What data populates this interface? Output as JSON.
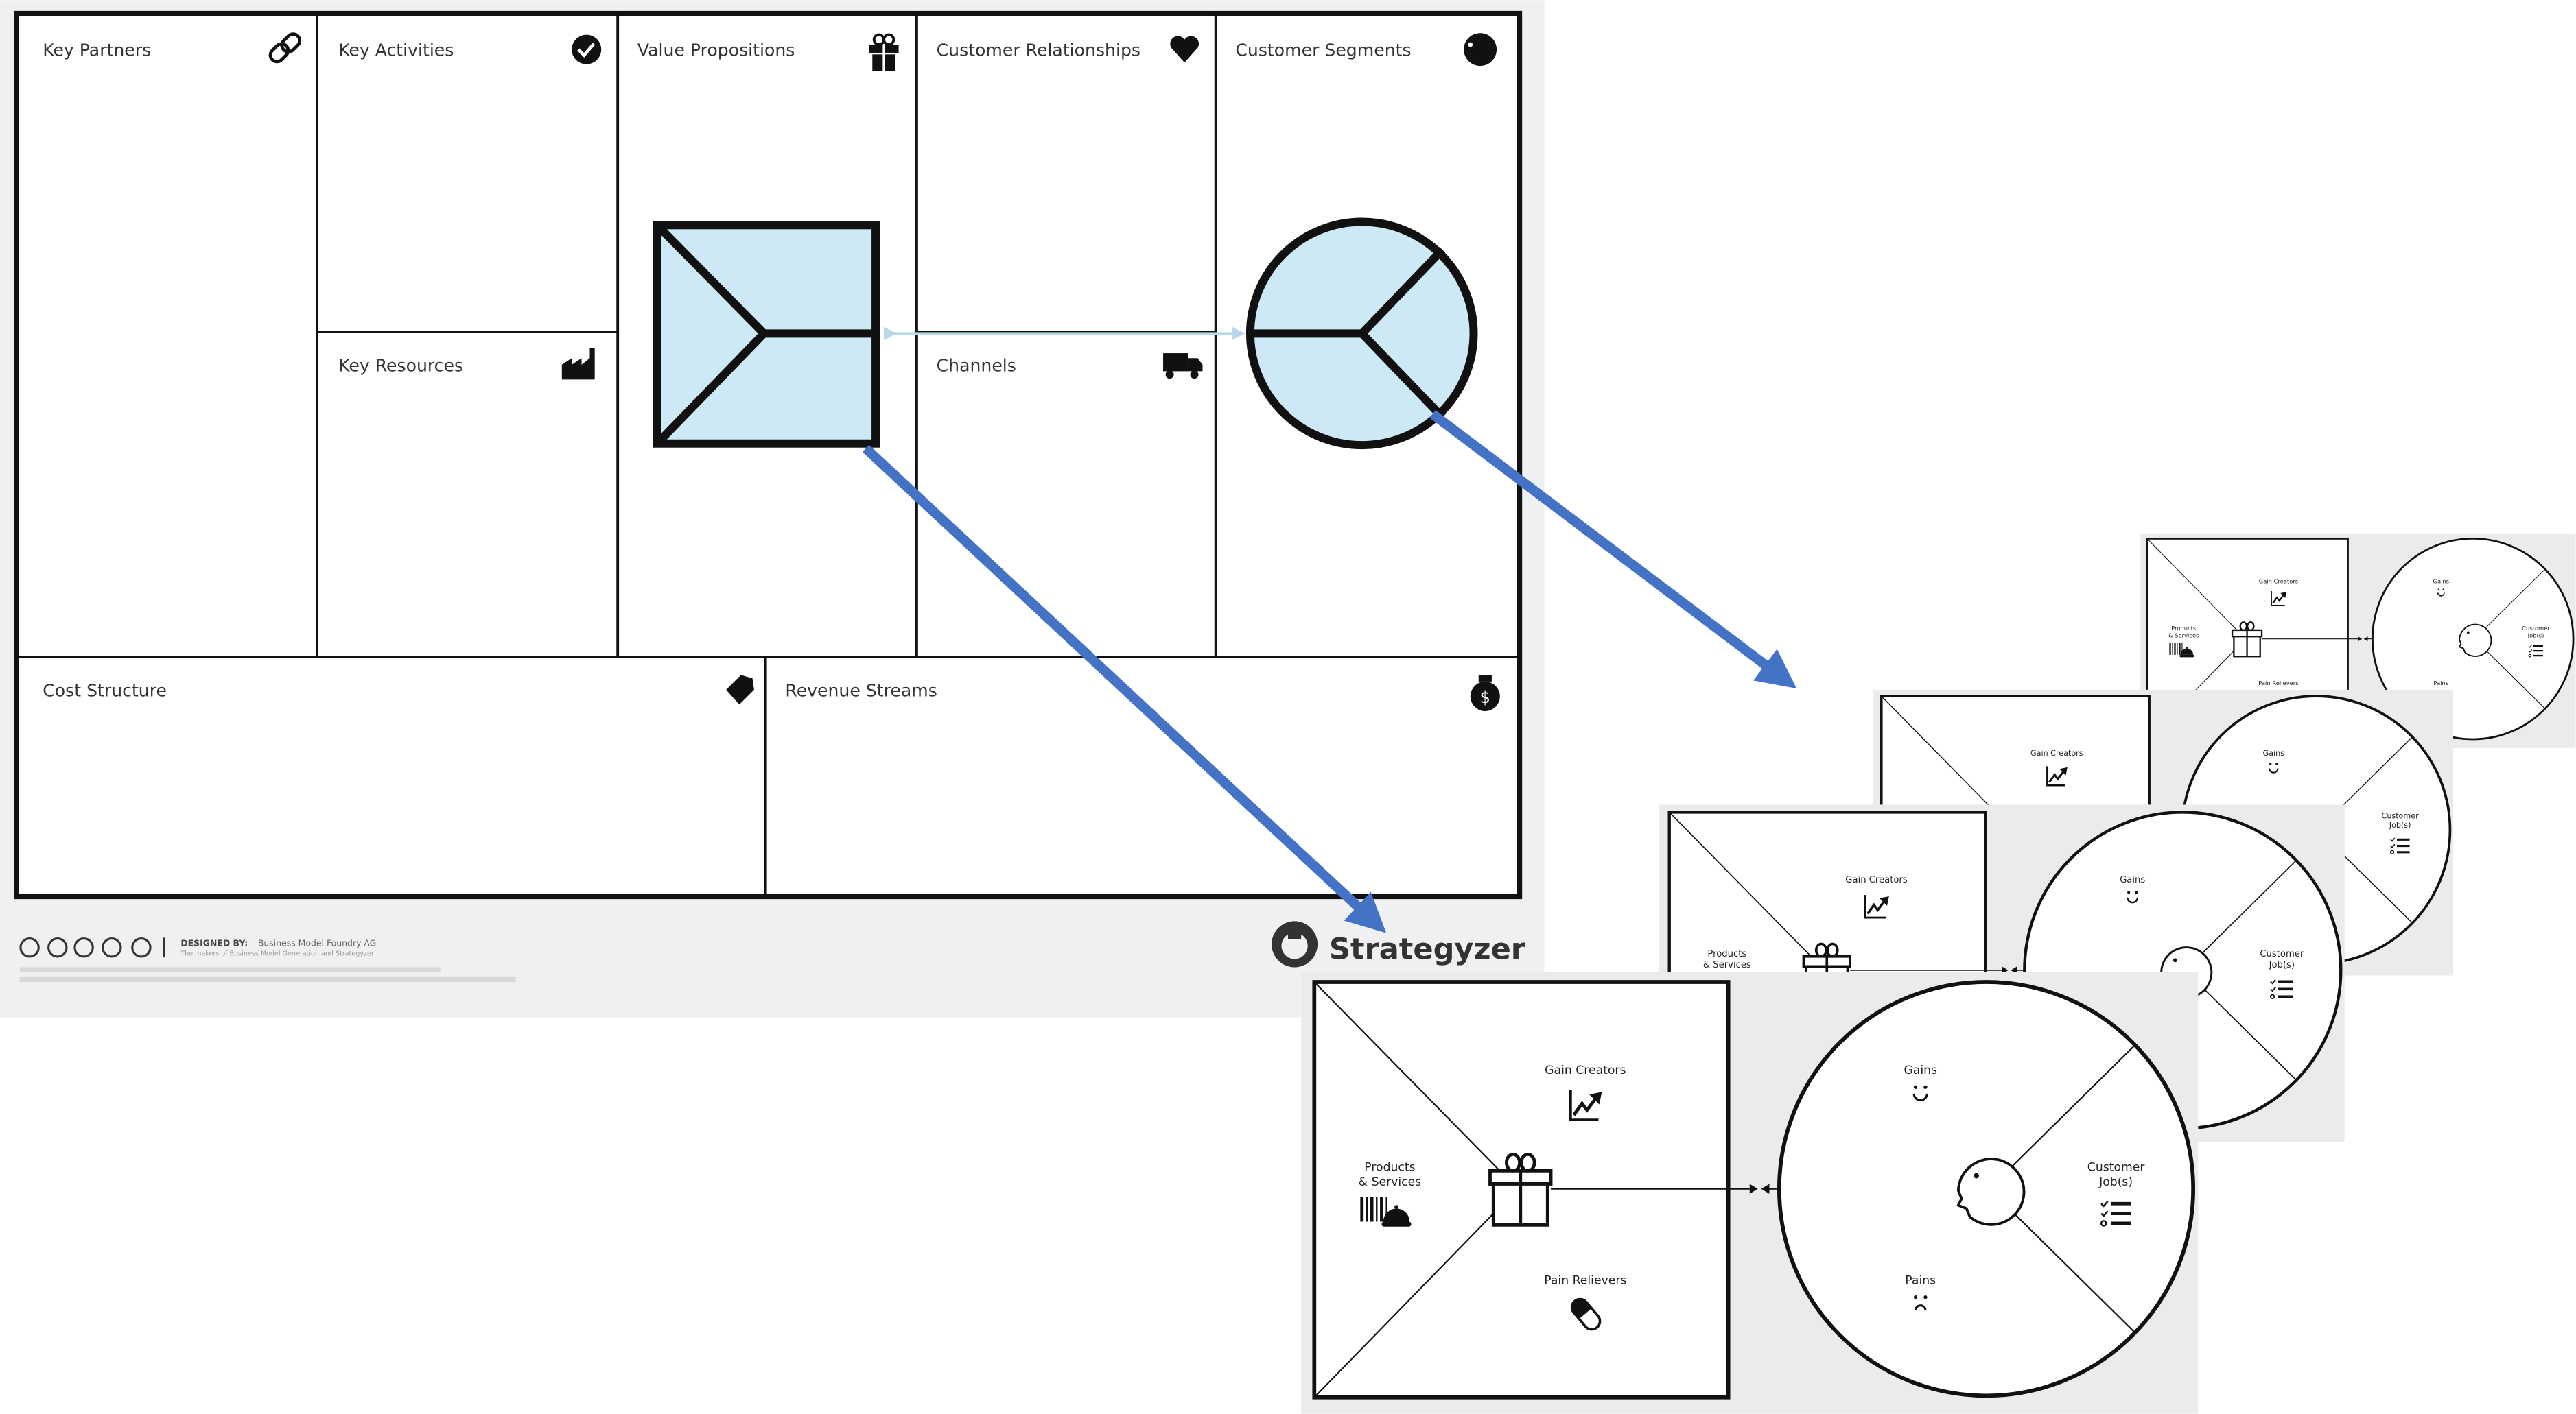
{
  "business_model_canvas": {
    "blocks": {
      "key_partners": "Key Partners",
      "key_activities": "Key Activities",
      "key_resources": "Key Resources",
      "value_propositions": "Value Propositions",
      "customer_relationships": "Customer Relationships",
      "channels": "Channels",
      "customer_segments": "Customer Segments",
      "cost_structure": "Cost Structure",
      "revenue_streams": "Revenue Streams"
    },
    "icons": {
      "key_partners": "link-icon",
      "key_activities": "check-circle-icon",
      "key_resources": "factory-icon",
      "value_propositions": "gift-icon",
      "customer_relationships": "heart-icon",
      "channels": "truck-icon",
      "customer_segments": "head-icon",
      "cost_structure": "tag-icon",
      "revenue_streams": "money-bag-icon"
    },
    "footer": {
      "designed_by_label": "DESIGNED BY:",
      "designed_by": "Business Model Foundry AG",
      "tagline": "The makers of Business Model Generation and Strategyzer"
    },
    "logo_text": "Strategyzer"
  },
  "value_proposition_canvas": {
    "gain_creators": "Gain Creators",
    "products_services_line1": "Products",
    "products_services_line2": "& Services",
    "pain_relievers": "Pain Relievers",
    "gains": "Gains",
    "customer_jobs_line1": "Customer",
    "customer_jobs_line2": "Job(s)",
    "pains": "Pains"
  },
  "colors": {
    "arrow": "#4472c4",
    "highlight_fill": "#cde9f5",
    "canvas_bg": "#eff0f1",
    "vpc_bg": "#ebebeb"
  }
}
